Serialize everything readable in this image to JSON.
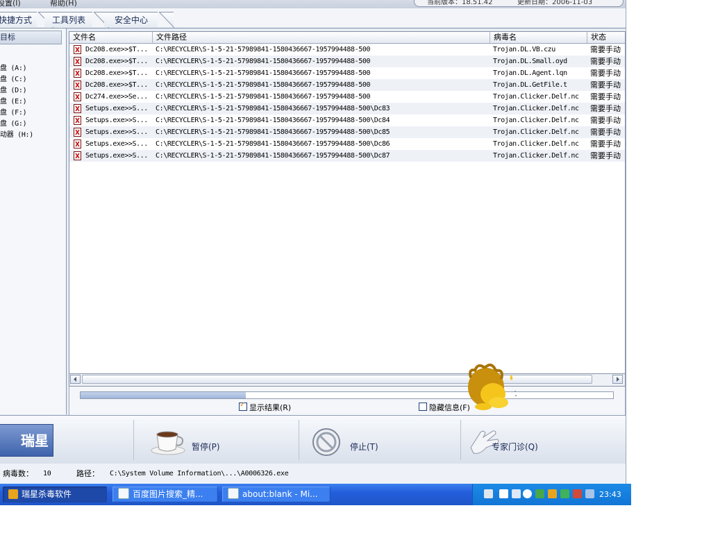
{
  "menu": {
    "settings": "设置(I)",
    "help": "帮助(H)"
  },
  "version": {
    "current": "当前版本：18.51.42",
    "updated": "更新日期：2006-11-03"
  },
  "tabs": [
    {
      "label": "快捷方式"
    },
    {
      "label": "工具列表"
    },
    {
      "label": "安全中心"
    }
  ],
  "left_panel": {
    "header": "目标",
    "drives": [
      "盘 (A:)",
      "盘 (C:)",
      "盘 (D:)",
      "盘 (E:)",
      "盘 (F:)",
      "盘 (G:)",
      "动器 (H:)"
    ]
  },
  "table": {
    "columns": [
      "文件名",
      "文件路径",
      "病毒名",
      "状态"
    ],
    "rows": [
      [
        "Dc208.exe>>$T...",
        "C:\\RECYCLER\\S-1-5-21-57989841-1580436667-1957994488-500",
        "Trojan.DL.VB.czu",
        "需要手动"
      ],
      [
        "Dc208.exe>>$T...",
        "C:\\RECYCLER\\S-1-5-21-57989841-1580436667-1957994488-500",
        "Trojan.DL.Small.oyd",
        "需要手动"
      ],
      [
        "Dc208.exe>>$T...",
        "C:\\RECYCLER\\S-1-5-21-57989841-1580436667-1957994488-500",
        "Trojan.DL.Agent.lqn",
        "需要手动"
      ],
      [
        "Dc208.exe>>$T...",
        "C:\\RECYCLER\\S-1-5-21-57989841-1580436667-1957994488-500",
        "Trojan.DL.GetFile.t",
        "需要手动"
      ],
      [
        "Dc274.exe>>Se...",
        "C:\\RECYCLER\\S-1-5-21-57989841-1580436667-1957994488-500",
        "Trojan.Clicker.Delf.nc",
        "需要手动"
      ],
      [
        "Setups.exe>>S...",
        "C:\\RECYCLER\\S-1-5-21-57989841-1580436667-1957994488-500\\Dc83",
        "Trojan.Clicker.Delf.nc",
        "需要手动"
      ],
      [
        "Setups.exe>>S...",
        "C:\\RECYCLER\\S-1-5-21-57989841-1580436667-1957994488-500\\Dc84",
        "Trojan.Clicker.Delf.nc",
        "需要手动"
      ],
      [
        "Setups.exe>>S...",
        "C:\\RECYCLER\\S-1-5-21-57989841-1580436667-1957994488-500\\Dc85",
        "Trojan.Clicker.Delf.nc",
        "需要手动"
      ],
      [
        "Setups.exe>>S...",
        "C:\\RECYCLER\\S-1-5-21-57989841-1580436667-1957994488-500\\Dc86",
        "Trojan.Clicker.Delf.nc",
        "需要手动"
      ],
      [
        "Setups.exe>>S...",
        "C:\\RECYCLER\\S-1-5-21-57989841-1580436667-1957994488-500\\Dc87",
        "Trojan.Clicker.Delf.nc",
        "需要手动"
      ]
    ]
  },
  "progress": {
    "fraction": 0.31
  },
  "options": {
    "show_results": "显示结果(R)",
    "show_results_checked": true,
    "hide_info": "隐藏信息(F)",
    "hide_info_checked": false
  },
  "toolbar": {
    "logo": "瑞星",
    "pause": "暂停(P)",
    "stop": "停止(T)",
    "expert": "专家门诊(Q)"
  },
  "status": {
    "virus_count_label": "病毒数：",
    "virus_count": "10",
    "path_label": "路径：",
    "path": "C:\\System Volume Information\\...\\A0006326.exe"
  },
  "taskbar": {
    "tasks": [
      "瑞星杀毒软件",
      "百度图片搜索_精...",
      "about:blank - Mi..."
    ],
    "clock": "23:43"
  },
  "colors": {
    "taskbar": "#245edb",
    "tray": "#1175d6",
    "accent": "#e07a10"
  }
}
